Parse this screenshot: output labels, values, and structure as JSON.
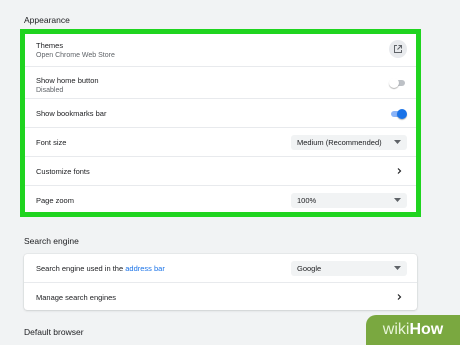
{
  "appearance": {
    "title": "Appearance",
    "themes": {
      "label": "Themes",
      "sub": "Open Chrome Web Store"
    },
    "home_button": {
      "label": "Show home button",
      "sub": "Disabled",
      "enabled": false
    },
    "bookmarks_bar": {
      "label": "Show bookmarks bar",
      "enabled": true
    },
    "font_size": {
      "label": "Font size",
      "value": "Medium (Recommended)"
    },
    "customize_fonts": {
      "label": "Customize fonts"
    },
    "page_zoom": {
      "label": "Page zoom",
      "value": "100%"
    }
  },
  "search_engine": {
    "title": "Search engine",
    "used_label_prefix": "Search engine used in the ",
    "used_label_link": "address bar",
    "value": "Google",
    "manage_label": "Manage search engines"
  },
  "default_browser": {
    "title": "Default browser"
  },
  "watermark": {
    "part1": "wiki",
    "part2": "How"
  },
  "colors": {
    "accent": "#1a73e8",
    "highlight": "#1fd41f",
    "background": "#f1f3f4"
  }
}
